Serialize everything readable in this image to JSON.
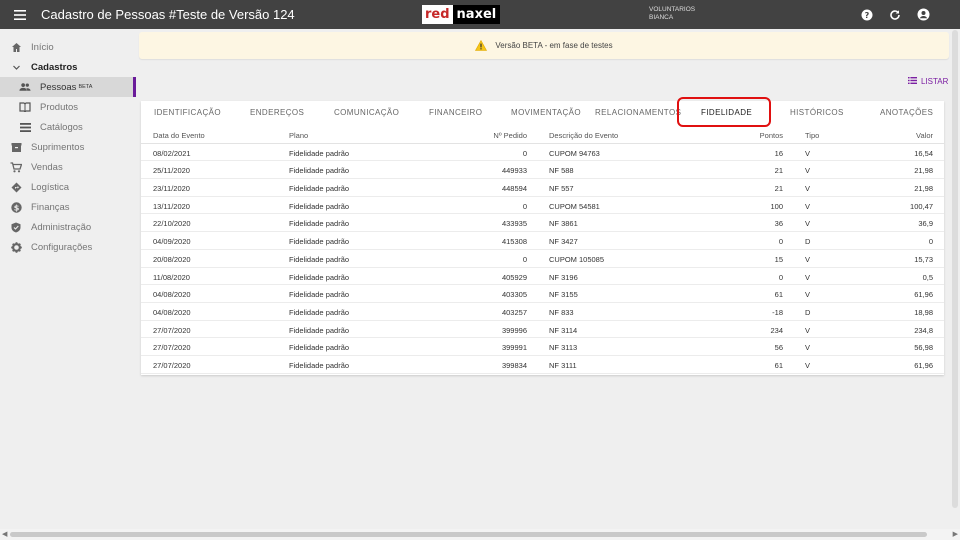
{
  "header": {
    "menu_icon": "menu-icon",
    "title": "Cadastro de Pessoas #Teste de Versão 124",
    "logo_red": "red",
    "logo_naxel": "naxel",
    "user_line1": "VOLUNTARIOS",
    "user_line2": "BIANCA",
    "icons": [
      "help-icon",
      "refresh-icon",
      "account-icon"
    ]
  },
  "sidebar": {
    "items": [
      {
        "label": "Início",
        "icon": "home-icon"
      },
      {
        "label": "Cadastros",
        "icon": "chevron-down-icon"
      },
      {
        "label": "Pessoas",
        "sup": "BETA",
        "icon": "people-icon"
      },
      {
        "label": "Produtos",
        "icon": "book-icon"
      },
      {
        "label": "Catálogos",
        "icon": "list-icon"
      },
      {
        "label": "Suprimentos",
        "icon": "box-icon"
      },
      {
        "label": "Vendas",
        "icon": "cart-icon"
      },
      {
        "label": "Logística",
        "icon": "route-icon"
      },
      {
        "label": "Finanças",
        "icon": "dollar-icon"
      },
      {
        "label": "Administração",
        "icon": "shield-icon"
      },
      {
        "label": "Configurações",
        "icon": "gear-icon"
      }
    ]
  },
  "banner": {
    "text": "Versão BETA - em fase de testes",
    "icon": "warning-icon"
  },
  "listar": {
    "label": "LISTAR",
    "icon": "list-icon"
  },
  "tabs": [
    "IDENTIFICAÇÃO",
    "ENDEREÇOS",
    "COMUNICAÇÃO",
    "FINANCEIRO",
    "MOVIMENTAÇÃO",
    "RELACIONAMENTOS",
    "FIDELIDADE",
    "HISTÓRICOS",
    "ANOTAÇÕES"
  ],
  "active_tab": "FIDELIDADE",
  "table": {
    "headers": {
      "data": "Data do Evento",
      "plano": "Plano",
      "pedido": "Nº Pedido",
      "desc": "Descrição do Evento",
      "pontos": "Pontos",
      "tipo": "Tipo",
      "valor": "Valor"
    },
    "rows": [
      {
        "data": "08/02/2021",
        "plano": "Fidelidade padrão",
        "pedido": "0",
        "desc": "CUPOM 94763",
        "pontos": "16",
        "tipo": "V",
        "valor": "16,54"
      },
      {
        "data": "25/11/2020",
        "plano": "Fidelidade padrão",
        "pedido": "449933",
        "desc": "NF 588",
        "pontos": "21",
        "tipo": "V",
        "valor": "21,98"
      },
      {
        "data": "23/11/2020",
        "plano": "Fidelidade padrão",
        "pedido": "448594",
        "desc": "NF 557",
        "pontos": "21",
        "tipo": "V",
        "valor": "21,98"
      },
      {
        "data": "13/11/2020",
        "plano": "Fidelidade padrão",
        "pedido": "0",
        "desc": "CUPOM 54581",
        "pontos": "100",
        "tipo": "V",
        "valor": "100,47"
      },
      {
        "data": "22/10/2020",
        "plano": "Fidelidade padrão",
        "pedido": "433935",
        "desc": "NF 3861",
        "pontos": "36",
        "tipo": "V",
        "valor": "36,9"
      },
      {
        "data": "04/09/2020",
        "plano": "Fidelidade padrão",
        "pedido": "415308",
        "desc": "NF 3427",
        "pontos": "0",
        "tipo": "D",
        "valor": "0"
      },
      {
        "data": "20/08/2020",
        "plano": "Fidelidade padrão",
        "pedido": "0",
        "desc": "CUPOM 105085",
        "pontos": "15",
        "tipo": "V",
        "valor": "15,73"
      },
      {
        "data": "11/08/2020",
        "plano": "Fidelidade padrão",
        "pedido": "405929",
        "desc": "NF 3196",
        "pontos": "0",
        "tipo": "V",
        "valor": "0,5"
      },
      {
        "data": "04/08/2020",
        "plano": "Fidelidade padrão",
        "pedido": "403305",
        "desc": "NF 3155",
        "pontos": "61",
        "tipo": "V",
        "valor": "61,96"
      },
      {
        "data": "04/08/2020",
        "plano": "Fidelidade padrão",
        "pedido": "403257",
        "desc": "NF 833",
        "pontos": "-18",
        "tipo": "D",
        "valor": "18,98"
      },
      {
        "data": "27/07/2020",
        "plano": "Fidelidade padrão",
        "pedido": "399996",
        "desc": "NF 3114",
        "pontos": "234",
        "tipo": "V",
        "valor": "234,8"
      },
      {
        "data": "27/07/2020",
        "plano": "Fidelidade padrão",
        "pedido": "399991",
        "desc": "NF 3113",
        "pontos": "56",
        "tipo": "V",
        "valor": "56,98"
      },
      {
        "data": "27/07/2020",
        "plano": "Fidelidade padrão",
        "pedido": "399834",
        "desc": "NF 3111",
        "pontos": "61",
        "tipo": "V",
        "valor": "61,96"
      }
    ]
  },
  "colors": {
    "topbar": "#424242",
    "accent": "#6a1b9a",
    "highlight": "#e01010",
    "banner": "#fdf6e3"
  }
}
